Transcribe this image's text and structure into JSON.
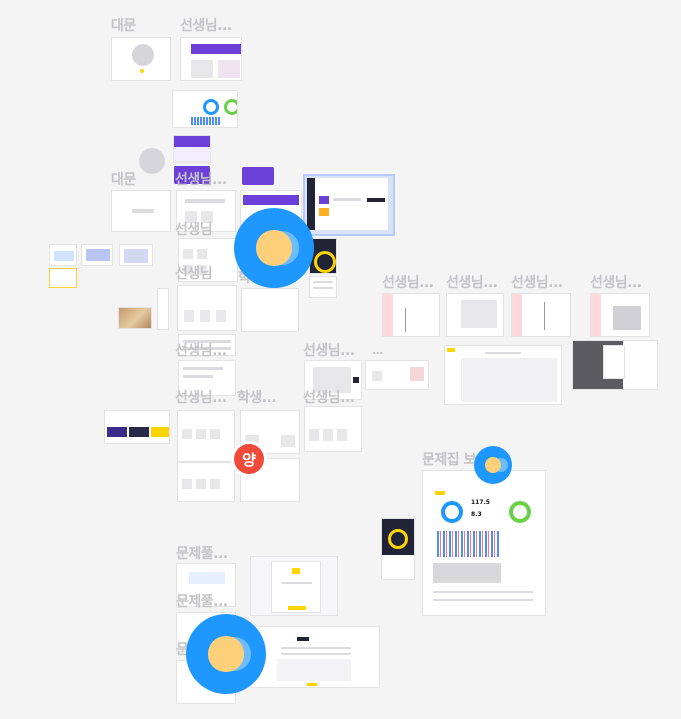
{
  "labels": {
    "l1": "대문",
    "l2": "선생님...",
    "l3": "대문",
    "l4": "선생님...",
    "l5": "선생님",
    "l6": "선생님",
    "l7": "학",
    "l8": "선생님...",
    "l9": "선생님...",
    "l10": "선생님...",
    "l11": "선생님...",
    "l12": "선생님...",
    "l13": "선생님...",
    "l14": "선생님...",
    "l15": "학생...",
    "l16": "선생님...",
    "l17": "문제집 보...",
    "l18": "문제풀...",
    "l19": "문제풀...",
    "l20": "문",
    "l21": "..."
  },
  "badges": {
    "red_avatar": "양"
  },
  "stats": {
    "s1": "117.5",
    "s2": "8.3"
  },
  "colors": {
    "accent_blue": "#1e98ff",
    "red": "#f04b3a",
    "yellow": "#ffd400",
    "purple": "#6b3fd8",
    "dark": "#202436"
  }
}
